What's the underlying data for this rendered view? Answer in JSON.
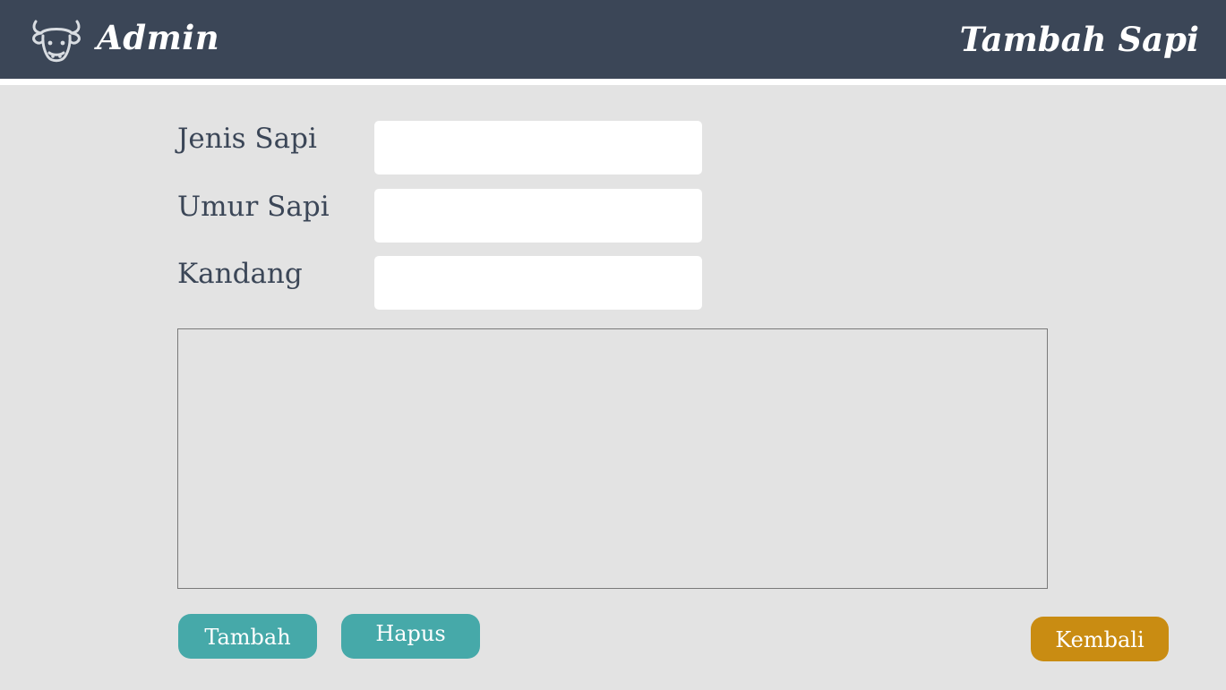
{
  "header": {
    "brand": "Admin",
    "page_title": "Tambah Sapi",
    "logo_icon": "cow-head-icon",
    "background_color": "#3b4657"
  },
  "form": {
    "fields": [
      {
        "label": "Jenis Sapi",
        "value": ""
      },
      {
        "label": "Umur Sapi",
        "value": ""
      },
      {
        "label": "Kandang",
        "value": ""
      }
    ]
  },
  "data_table": {
    "rows": []
  },
  "actions": {
    "add_label": "Tambah",
    "delete_label": "Hapus",
    "back_label": "Kembali"
  },
  "colors": {
    "accent_teal": "#46a9a9",
    "accent_gold": "#c98c12",
    "page_background": "#e3e3e3"
  }
}
